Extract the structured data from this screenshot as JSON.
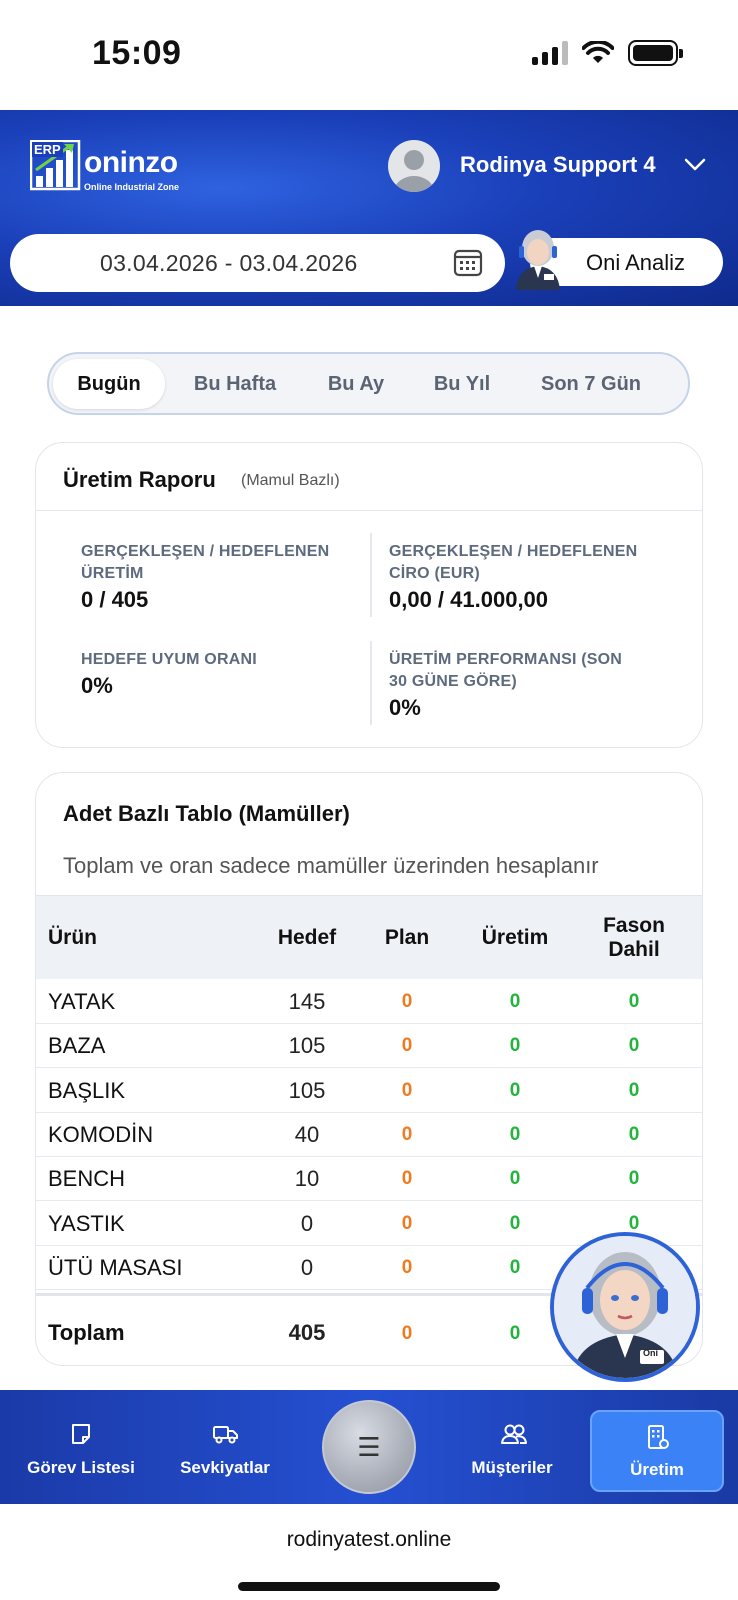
{
  "status": {
    "time": "15:09"
  },
  "header": {
    "logo_erp": "ERP",
    "logo_name": "oninzo",
    "logo_tagline": "Online Industrial Zone",
    "user_name": "Rodinya Support 4",
    "date_range": "03.04.2026 - 03.04.2026",
    "oni_button": "Oni Analiz"
  },
  "tabs": [
    {
      "label": "Bugün",
      "active": true
    },
    {
      "label": "Bu Hafta",
      "active": false
    },
    {
      "label": "Bu Ay",
      "active": false
    },
    {
      "label": "Bu Yıl",
      "active": false
    },
    {
      "label": "Son 7 Gün",
      "active": false
    }
  ],
  "report": {
    "title": "Üretim Raporu",
    "subtitle": "(Mamul Bazlı)",
    "metrics": [
      {
        "label_line1": "GERÇEKLEŞEN / HEDEFLENEN",
        "label_line2": "ÜRETİM",
        "value": "0 / 405"
      },
      {
        "label_line1": "GERÇEKLEŞEN / HEDEFLENEN",
        "label_line2": "CİRO (EUR)",
        "value": "0,00 / 41.000,00"
      },
      {
        "label_line1": "HEDEFE UYUM ORANI",
        "label_line2": "",
        "value": "0%"
      },
      {
        "label_line1": "ÜRETİM PERFORMANSI (SON",
        "label_line2": "30 GÜNE GÖRE)",
        "value": "0%"
      }
    ]
  },
  "table": {
    "title": "Adet Bazlı Tablo (Mamüller)",
    "subtitle": "Toplam ve oran sadece mamüller üzerinden hesaplanır",
    "headers": {
      "product": "Ürün",
      "target": "Hedef",
      "plan": "Plan",
      "production": "Üretim",
      "fason_line1": "Fason",
      "fason_line2": "Dahil"
    },
    "rows": [
      {
        "product": "YATAK",
        "target": "145",
        "plan": "0",
        "production": "0",
        "fason": "0"
      },
      {
        "product": "BAZA",
        "target": "105",
        "plan": "0",
        "production": "0",
        "fason": "0"
      },
      {
        "product": "BAŞLIK",
        "target": "105",
        "plan": "0",
        "production": "0",
        "fason": "0"
      },
      {
        "product": "KOMODİN",
        "target": "40",
        "plan": "0",
        "production": "0",
        "fason": "0"
      },
      {
        "product": "BENCH",
        "target": "10",
        "plan": "0",
        "production": "0",
        "fason": "0"
      },
      {
        "product": "YASTIK",
        "target": "0",
        "plan": "0",
        "production": "0",
        "fason": "0"
      },
      {
        "product": "ÜTÜ MASASI",
        "target": "0",
        "plan": "0",
        "production": "0",
        "fason": ""
      }
    ],
    "total": {
      "label": "Toplam",
      "target": "405",
      "plan": "0",
      "production": "0"
    }
  },
  "oni_badge": "Oni",
  "bottom_nav": [
    {
      "label": "Görev Listesi",
      "icon": "note-icon"
    },
    {
      "label": "Sevkiyatlar",
      "icon": "truck-icon"
    },
    {
      "label": "Müşteriler",
      "icon": "users-icon"
    },
    {
      "label": "Üretim",
      "icon": "building-gear-icon",
      "active": true
    }
  ],
  "menu_glyph": "☰",
  "browser": {
    "url": "rodinyatest.online"
  },
  "colors": {
    "brand_blue": "#1a3fb8",
    "plan_orange": "#f07a20",
    "ok_green": "#22b43c",
    "active_nav": "#3b82f6"
  }
}
